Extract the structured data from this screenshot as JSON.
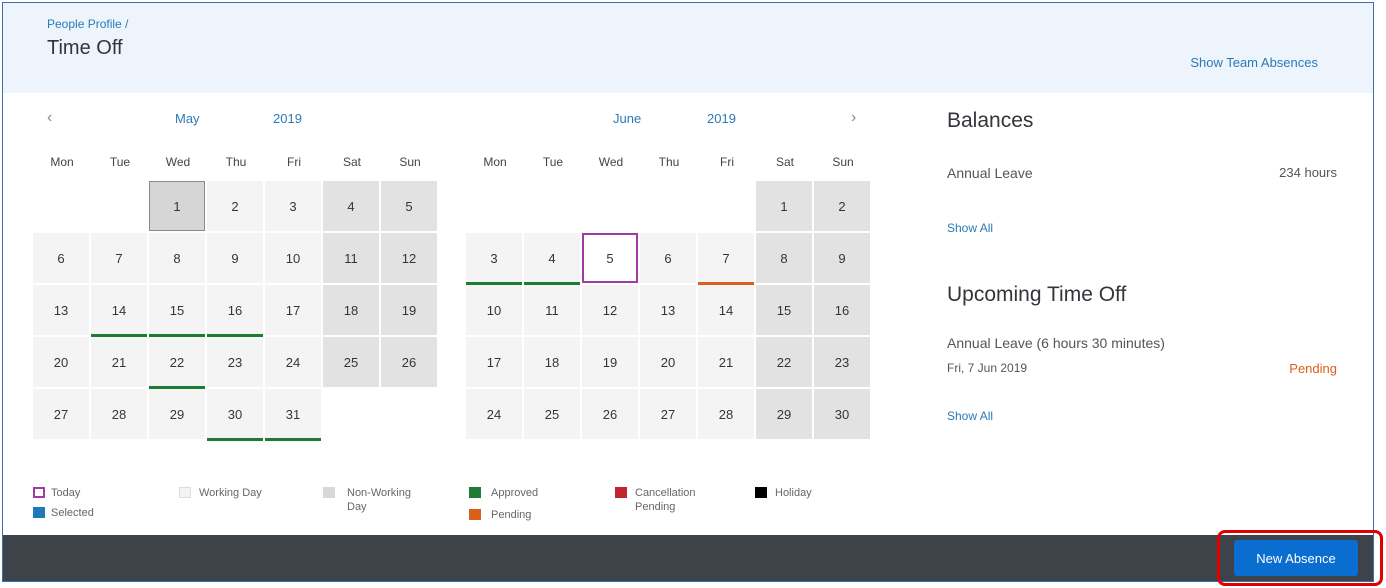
{
  "header": {
    "breadcrumb": "People Profile /",
    "title": "Time Off",
    "team_link": "Show Team Absences"
  },
  "nav": {
    "prev_icon": "chevron-left-icon",
    "next_icon": "chevron-right-icon",
    "prev_glyph": "‹",
    "next_glyph": "›"
  },
  "calendars": [
    {
      "month": "May",
      "year": "2019",
      "weekdays": [
        "Mon",
        "Tue",
        "Wed",
        "Thu",
        "Fri",
        "Sat",
        "Sun"
      ],
      "lead_blanks": 2,
      "days": 31,
      "selected_day": 1,
      "approved_days": [
        14,
        15,
        16,
        22,
        30,
        31
      ],
      "pending_days": [],
      "today": null
    },
    {
      "month": "June",
      "year": "2019",
      "weekdays": [
        "Mon",
        "Tue",
        "Wed",
        "Thu",
        "Fri",
        "Sat",
        "Sun"
      ],
      "lead_blanks": 5,
      "days": 30,
      "selected_day": null,
      "approved_days": [
        3,
        4
      ],
      "pending_days": [
        7
      ],
      "today": 5
    }
  ],
  "balances": {
    "title": "Balances",
    "item_label": "Annual Leave",
    "item_value": "234 hours",
    "show_all": "Show All"
  },
  "upcoming": {
    "title": "Upcoming Time Off",
    "item_label": "Annual Leave (6 hours 30 minutes)",
    "item_date": "Fri, 7 Jun 2019",
    "item_status": "Pending",
    "show_all": "Show All"
  },
  "legend": {
    "today": "Today",
    "selected": "Selected",
    "working_day": "Working Day",
    "non_working_day": "Non-Working Day",
    "approved": "Approved",
    "pending": "Pending",
    "cancellation_pending": "Cancellation Pending",
    "holiday": "Holiday"
  },
  "colors": {
    "approved": "#1e7b35",
    "pending": "#d9601a",
    "cancellation": "#c0262d",
    "holiday": "#000000",
    "selected": "#1f79b8",
    "today": "#a23ba1",
    "working": "#f4f4f4",
    "non_working": "#e2e2e2",
    "accent": "#0a6ed1"
  },
  "footer": {
    "new_absence_label": "New Absence"
  }
}
